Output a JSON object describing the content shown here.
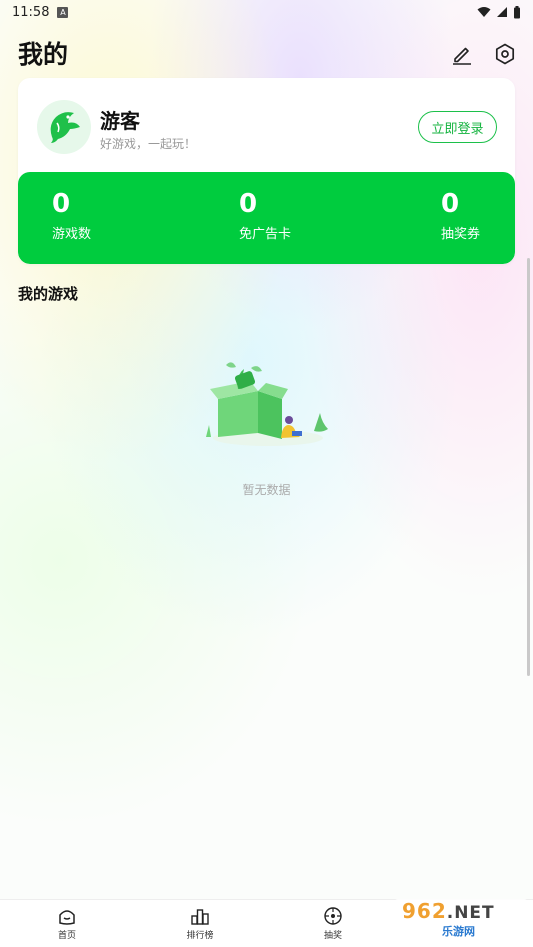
{
  "status_bar": {
    "time": "11:58",
    "badge": "A"
  },
  "header": {
    "title": "我的",
    "icons": [
      "edit-icon",
      "settings-icon"
    ]
  },
  "profile": {
    "name": "游客",
    "subtitle": "好游戏，一起玩！",
    "login_button": "立即登录"
  },
  "stats": [
    {
      "value": "0",
      "label": "游戏数"
    },
    {
      "value": "0",
      "label": "免广告卡"
    },
    {
      "value": "0",
      "label": "抽奖券"
    }
  ],
  "my_games": {
    "title": "我的游戏",
    "empty_text": "暂无数据"
  },
  "bottom_nav": [
    {
      "label": "首页",
      "icon": "home-icon"
    },
    {
      "label": "排行榜",
      "icon": "ranking-icon"
    },
    {
      "label": "抽奖",
      "icon": "lottery-icon"
    }
  ],
  "watermark": {
    "main": "962",
    "suffix": ".NET",
    "sub": "乐游网"
  },
  "colors": {
    "accent": "#00cc3e",
    "button_border": "#1cc04a"
  }
}
